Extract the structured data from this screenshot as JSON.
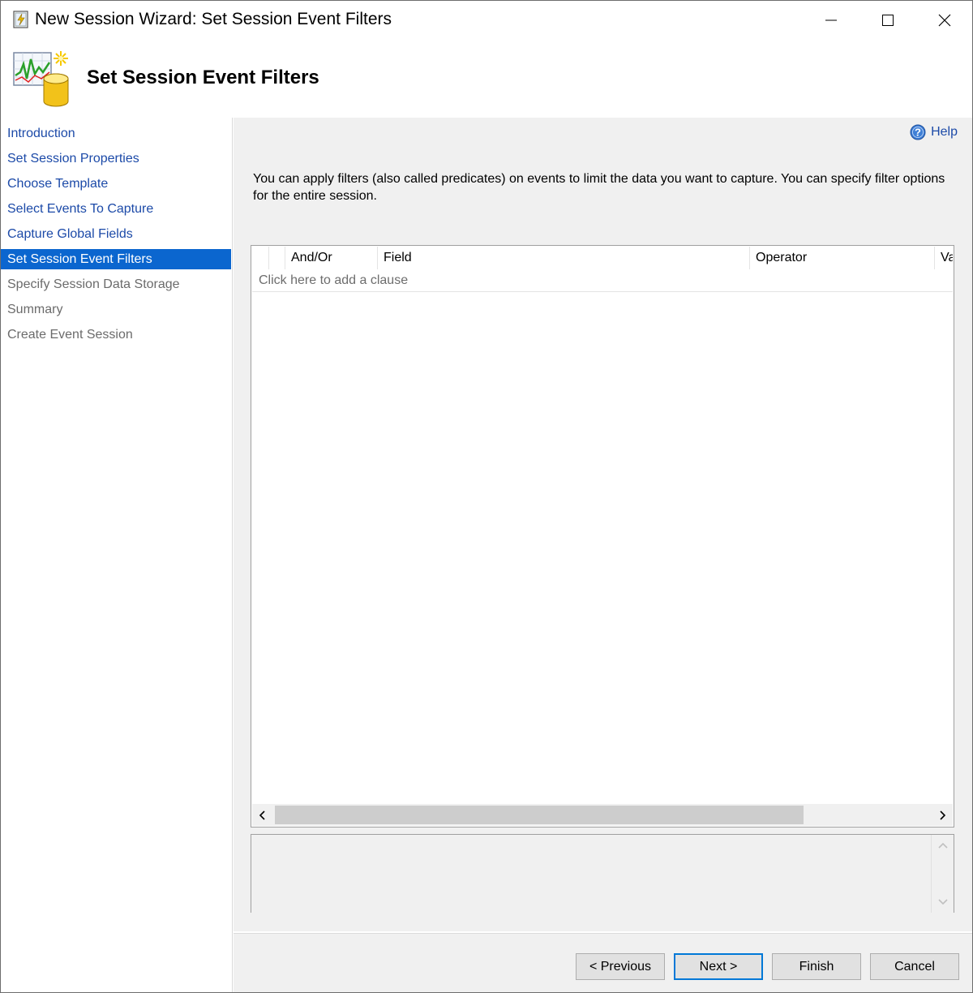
{
  "window": {
    "title": "New Session Wizard: Set Session Event Filters",
    "controls": [
      "minimize-icon",
      "maximize-icon",
      "close-icon"
    ]
  },
  "header": {
    "title": "Set Session Event Filters",
    "icon": "xevent-session-icon"
  },
  "sidebar": {
    "items": [
      {
        "label": "Introduction",
        "state": "link"
      },
      {
        "label": "Set Session Properties",
        "state": "link"
      },
      {
        "label": "Choose Template",
        "state": "link"
      },
      {
        "label": "Select Events To Capture",
        "state": "link"
      },
      {
        "label": "Capture Global Fields",
        "state": "link"
      },
      {
        "label": "Set Session Event Filters",
        "state": "active"
      },
      {
        "label": "Specify Session Data Storage",
        "state": "disabled"
      },
      {
        "label": "Summary",
        "state": "disabled"
      },
      {
        "label": "Create Event Session",
        "state": "disabled"
      }
    ]
  },
  "main": {
    "help_label": "Help",
    "description": "You can apply filters (also called predicates) on events to limit the data you want to capture. You can specify filter options for the entire session.",
    "grid": {
      "columns": [
        "",
        "And/Or",
        "Field",
        "Operator",
        "Va"
      ],
      "add_clause_text": "Click here to add a clause",
      "horizontal_scroll_position": 0
    }
  },
  "footer": {
    "previous_label": "< Previous",
    "next_label": "Next >",
    "finish_label": "Finish",
    "cancel_label": "Cancel"
  },
  "colors": {
    "active_nav": "#0b66cf",
    "link": "#1c4aa8",
    "disabled": "#6b6b6b",
    "panel": "#f0f0f0"
  }
}
